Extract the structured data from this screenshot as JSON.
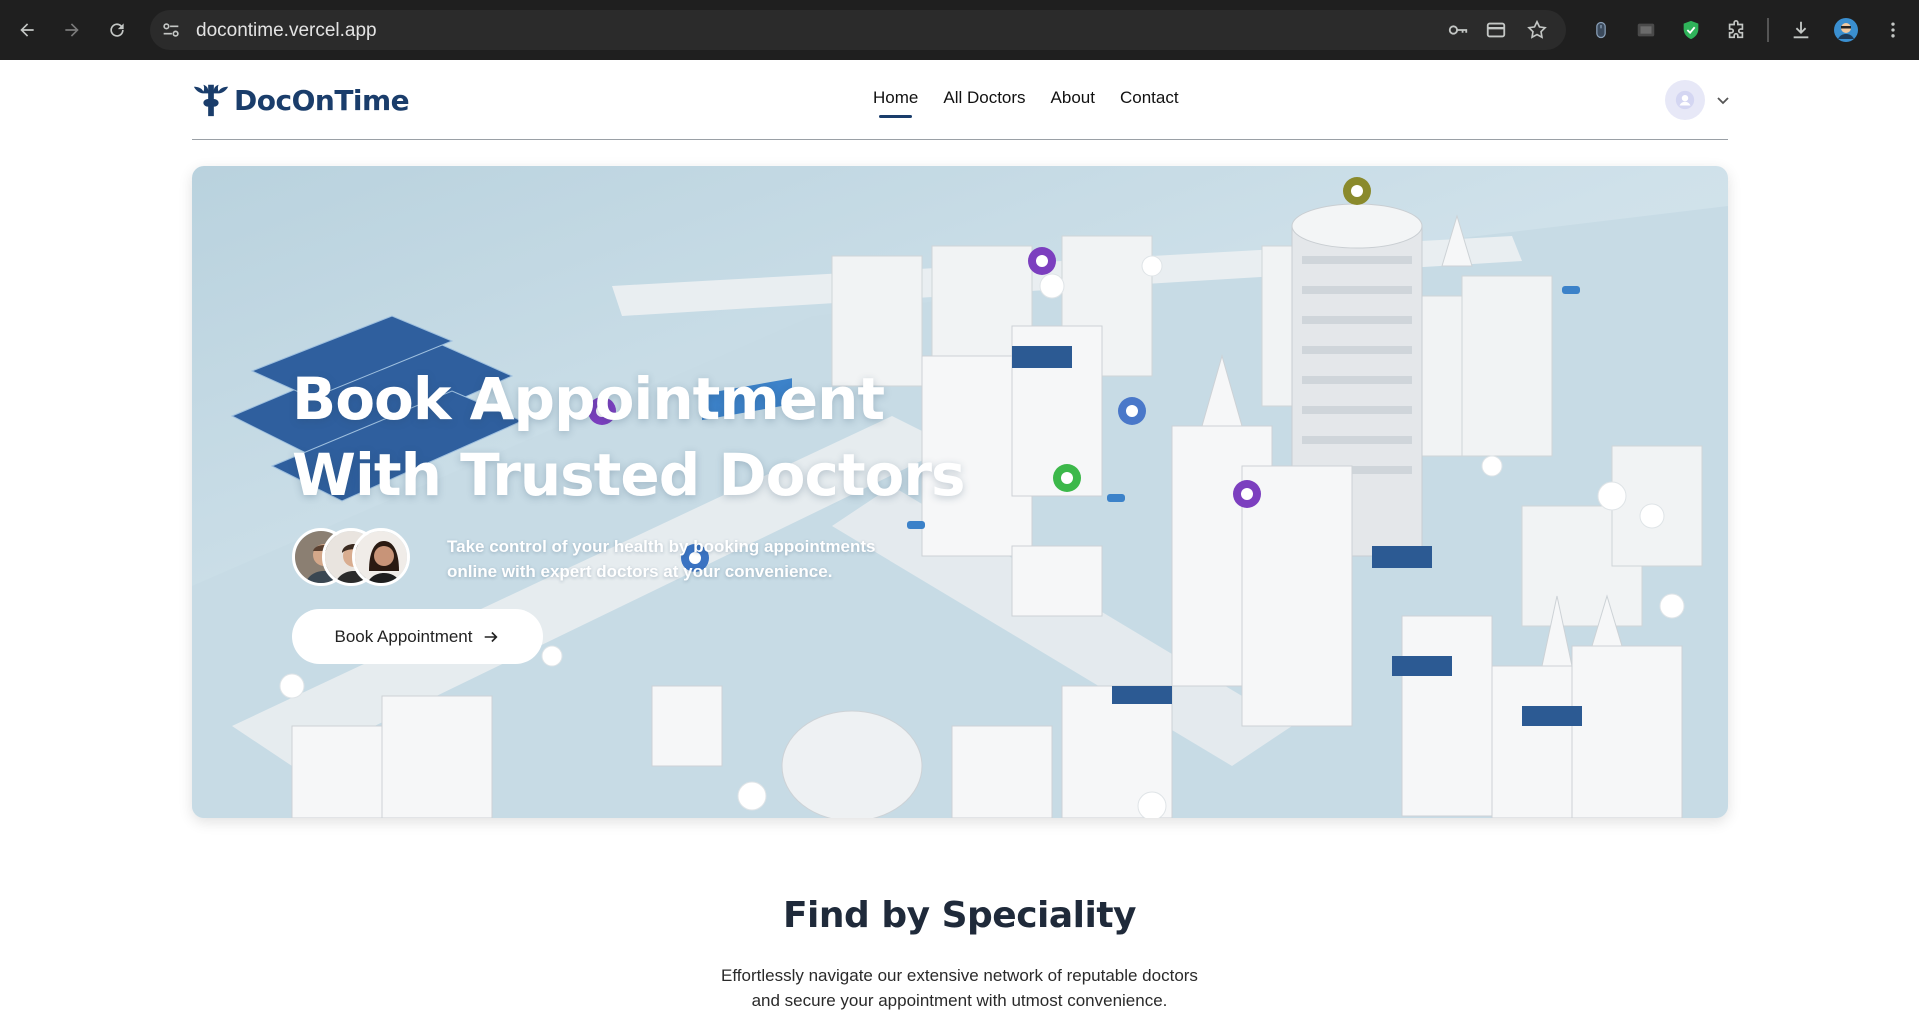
{
  "browser": {
    "url": "docontime.vercel.app"
  },
  "header": {
    "brand": "DocOnTime",
    "nav": [
      {
        "label": "Home",
        "active": true
      },
      {
        "label": "All Doctors",
        "active": false
      },
      {
        "label": "About",
        "active": false
      },
      {
        "label": "Contact",
        "active": false
      }
    ]
  },
  "hero": {
    "title_line1": "Book Appointment",
    "title_line2": "With Trusted Doctors",
    "subtitle": "Take control of your health by booking appointments online with expert doctors at your convenience.",
    "cta_label": "Book Appointment"
  },
  "speciality": {
    "title": "Find by Speciality",
    "subtitle_line1": "Effortlessly navigate our extensive network of reputable doctors",
    "subtitle_line2": "and secure your appointment with utmost convenience."
  },
  "colors": {
    "brand": "#1a3d6b",
    "chrome_bg": "#1f1f1f",
    "hero_bg": "#cfe1ea"
  },
  "icons": [
    "back-icon",
    "forward-icon",
    "reload-icon",
    "site-info-icon",
    "password-key-icon",
    "card-icon",
    "bookmark-star-icon",
    "extension-mouse-icon",
    "extension-window-icon",
    "extension-shield-icon",
    "extensions-puzzle-icon",
    "download-icon",
    "profile-icon",
    "menu-dots-icon",
    "user-avatar-icon",
    "chevron-down-icon",
    "arrow-right-icon"
  ]
}
